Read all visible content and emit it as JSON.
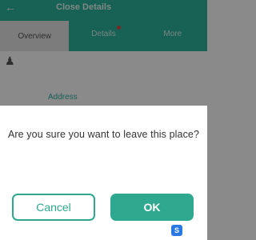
{
  "background": {
    "appbar": {
      "back_icon": "back-arrow-icon",
      "title": "Close Details",
      "extra": ""
    },
    "tabs": [
      {
        "label": "Overview",
        "active": true
      },
      {
        "label": "Details",
        "badge": true
      },
      {
        "label": "More"
      }
    ],
    "row": {
      "icon": "user-icon",
      "text": ""
    },
    "link": "Address"
  },
  "dialog": {
    "message": "Are you sure you want to leave this place?",
    "sub1": "",
    "sub2": "",
    "cancel_label": "Cancel",
    "ok_label": "OK"
  },
  "watermark": {
    "logo": "S",
    "text": ""
  },
  "colors": {
    "accent": "#2ea990",
    "appbar": "#2bb39e"
  }
}
